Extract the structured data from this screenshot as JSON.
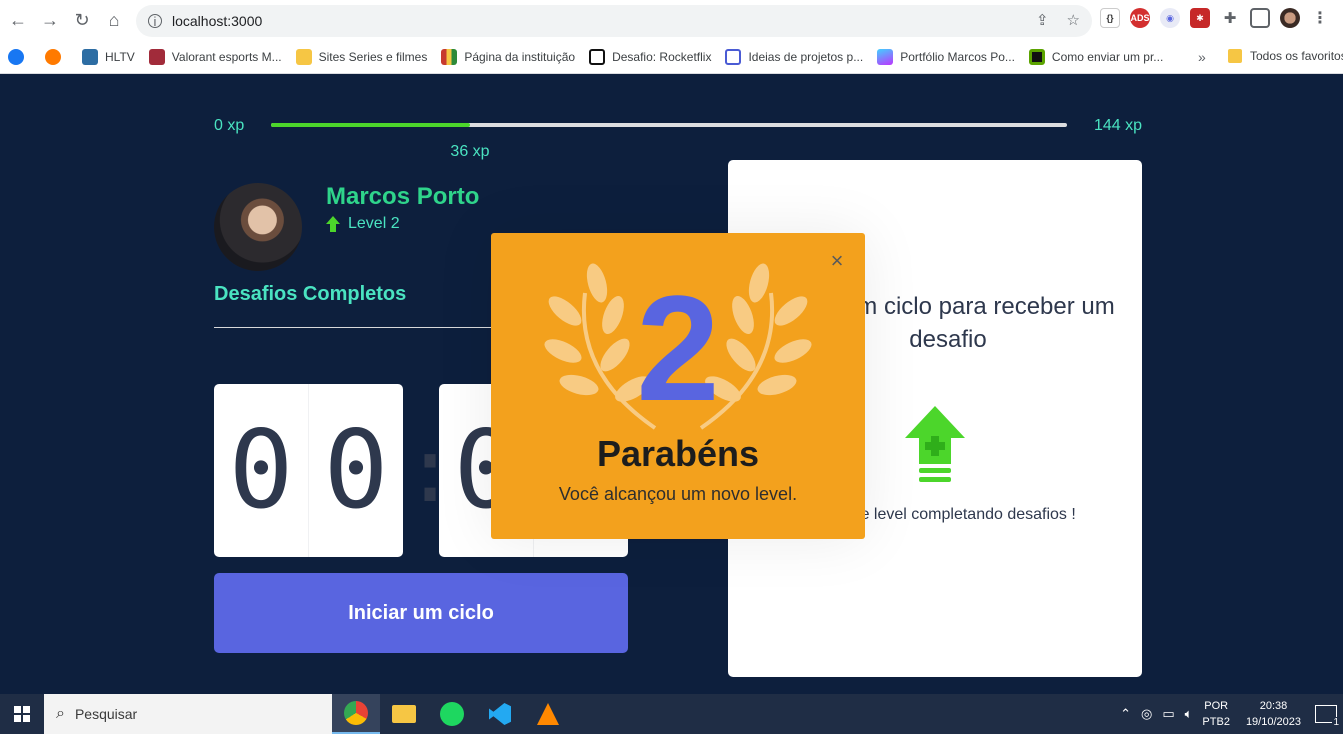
{
  "browser": {
    "url": "localhost:3000",
    "bookmarks": [
      {
        "label": "",
        "color": "#1877f2",
        "icon": "facebook-icon"
      },
      {
        "label": "",
        "color": "#ff7a00",
        "icon": "crunchyroll-icon"
      },
      {
        "label": "HLTV",
        "color": "#2d6da3",
        "icon": "hltv-icon"
      },
      {
        "label": "Valorant esports M...",
        "color": "#a12b3a",
        "icon": "valorant-icon"
      },
      {
        "label": "Sites Series e filmes",
        "color": "#f6c644",
        "icon": "folder-icon"
      },
      {
        "label": "Página da instituição",
        "color": "#c73a2e",
        "icon": "institution-icon"
      },
      {
        "label": "Desafio: Rocketflix",
        "color": "#111111",
        "icon": "notion-icon"
      },
      {
        "label": "Ideias de projetos p...",
        "color": "#4a5bd4",
        "icon": "board-icon"
      },
      {
        "label": "Portfólio Marcos Po...",
        "color": "#9b5de5",
        "icon": "vite-icon"
      },
      {
        "label": "Como enviar um pr...",
        "color": "#5ba300",
        "icon": "guide-icon"
      }
    ],
    "more": "»",
    "last_folder": "Todos os favoritos"
  },
  "app": {
    "xp": {
      "min": "0 xp",
      "max": "144 xp",
      "current": "36 xp",
      "progress": 0.25
    },
    "profile": {
      "name": "Marcos Porto",
      "level": "Level 2"
    },
    "completed_label": "Desafios Completos",
    "countdown": {
      "minute_left": "0",
      "minute_right": "0",
      "colon": ":",
      "second_left": "0",
      "second_right": "0"
    },
    "start_button": "Iniciar um ciclo",
    "challenge": {
      "title": "Inicie um ciclo para receber um desafio",
      "text": "Avance de level completando desafios !"
    },
    "modal": {
      "level": "2",
      "title": "Parabéns",
      "subtitle": "Você alcançou um novo level.",
      "close": "×"
    },
    "colors": {
      "accent": "#5965e0",
      "green": "#4cd62b",
      "modal_bg": "#f3a11d",
      "bg": "#0d1f3d"
    }
  },
  "taskbar": {
    "search_placeholder": "Pesquisar",
    "lang_top": "POR",
    "lang_bottom": "PTB2",
    "time": "20:38",
    "date": "19/10/2023",
    "notifications": "1"
  }
}
